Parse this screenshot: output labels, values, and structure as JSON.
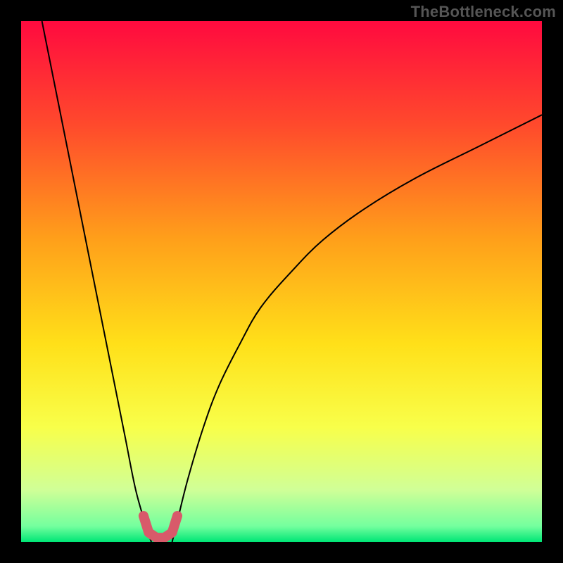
{
  "watermark": "TheBottleneck.com",
  "chart_data": {
    "type": "line",
    "title": "",
    "xlabel": "",
    "ylabel": "",
    "xlim": [
      0,
      100
    ],
    "ylim": [
      0,
      100
    ],
    "grid": false,
    "legend": false,
    "background_gradient_vertical": [
      {
        "offset": 0,
        "color": "#ff0a3f"
      },
      {
        "offset": 20,
        "color": "#ff4a2c"
      },
      {
        "offset": 42,
        "color": "#ffa01a"
      },
      {
        "offset": 62,
        "color": "#ffe019"
      },
      {
        "offset": 78,
        "color": "#f8ff4a"
      },
      {
        "offset": 90,
        "color": "#d0ff97"
      },
      {
        "offset": 97,
        "color": "#74ff9e"
      },
      {
        "offset": 100,
        "color": "#00e676"
      }
    ],
    "series": [
      {
        "name": "left-branch",
        "stroke": "#000000",
        "stroke_width": 2,
        "x": [
          4,
          6,
          8,
          10,
          12,
          14,
          16,
          18,
          20,
          22,
          24,
          25
        ],
        "y": [
          100,
          90,
          80,
          70,
          60,
          50,
          40,
          30,
          20,
          10,
          3,
          0
        ]
      },
      {
        "name": "right-branch",
        "stroke": "#000000",
        "stroke_width": 2,
        "x": [
          29,
          30,
          32,
          35,
          38,
          42,
          46,
          52,
          58,
          66,
          76,
          88,
          100
        ],
        "y": [
          0,
          4,
          12,
          22,
          30,
          38,
          45,
          52,
          58,
          64,
          70,
          76,
          82
        ]
      },
      {
        "name": "bottleneck-marker",
        "type": "marker-path",
        "stroke": "#d85a6a",
        "stroke_width": 14,
        "linecap": "round",
        "x": [
          23.5,
          24.5,
          26,
          27.5,
          29,
          30
        ],
        "y": [
          5,
          1.8,
          0.8,
          0.8,
          1.8,
          5
        ]
      }
    ]
  }
}
